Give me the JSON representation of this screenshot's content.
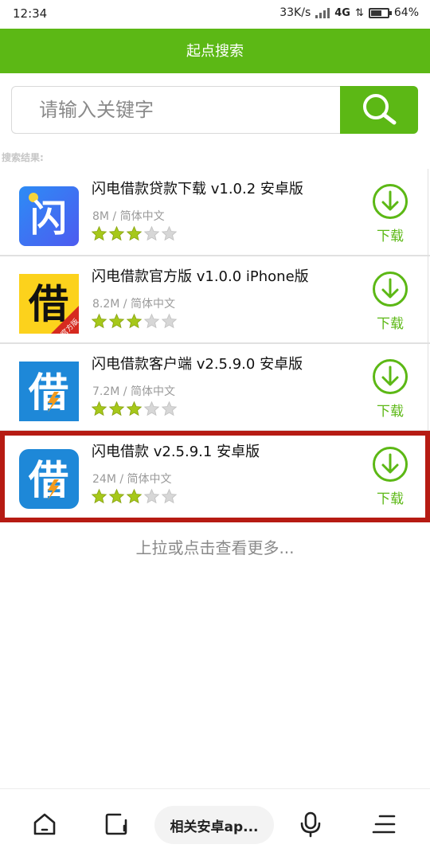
{
  "status_bar": {
    "time": "12:34",
    "net_speed": "33K/s",
    "network": "4G",
    "battery": "64%",
    "battery_level": 0.64
  },
  "header": {
    "title": "起点搜索"
  },
  "search": {
    "placeholder": "请输入关键字",
    "button_icon": "search-icon"
  },
  "results_label": "搜索结果:",
  "results": [
    {
      "name": "闪电借款贷款下载 v1.0.2 安卓版",
      "meta": "8M / 简体中文",
      "rating": 3,
      "max_rating": 5,
      "download_label": "下载",
      "icon": "blue-flash-logo",
      "icon_text": "闪"
    },
    {
      "name": "闪电借款官方版 v1.0.0 iPhone版",
      "meta": "8.2M / 简体中文",
      "rating": 3,
      "max_rating": 5,
      "download_label": "下载",
      "icon": "yellow-borrow-logo",
      "icon_text": "借",
      "icon_badge": "官方版"
    },
    {
      "name": "闪电借款客户端 v2.5.9.0 安卓版",
      "meta": "7.2M / 简体中文",
      "rating": 3,
      "max_rating": 5,
      "download_label": "下载",
      "icon": "blue-borrow-logo",
      "icon_text": "借"
    },
    {
      "name": "闪电借款 v2.5.9.1 安卓版",
      "meta": "24M / 简体中文",
      "rating": 3,
      "max_rating": 5,
      "download_label": "下载",
      "icon": "blue-borrow-logo",
      "icon_text": "借",
      "highlighted": true
    }
  ],
  "load_more": "上拉或点击查看更多...",
  "bottom_nav": {
    "home_icon": "home-icon",
    "tabs_icon": "tabs-icon",
    "query_pill": "相关安卓ap...",
    "mic_icon": "microphone-icon",
    "menu_icon": "menu-icon"
  },
  "colors": {
    "accent": "#5cb815",
    "highlight": "#b61b13",
    "star_on": "#a6c81a",
    "star_off": "#d7d7d7"
  }
}
